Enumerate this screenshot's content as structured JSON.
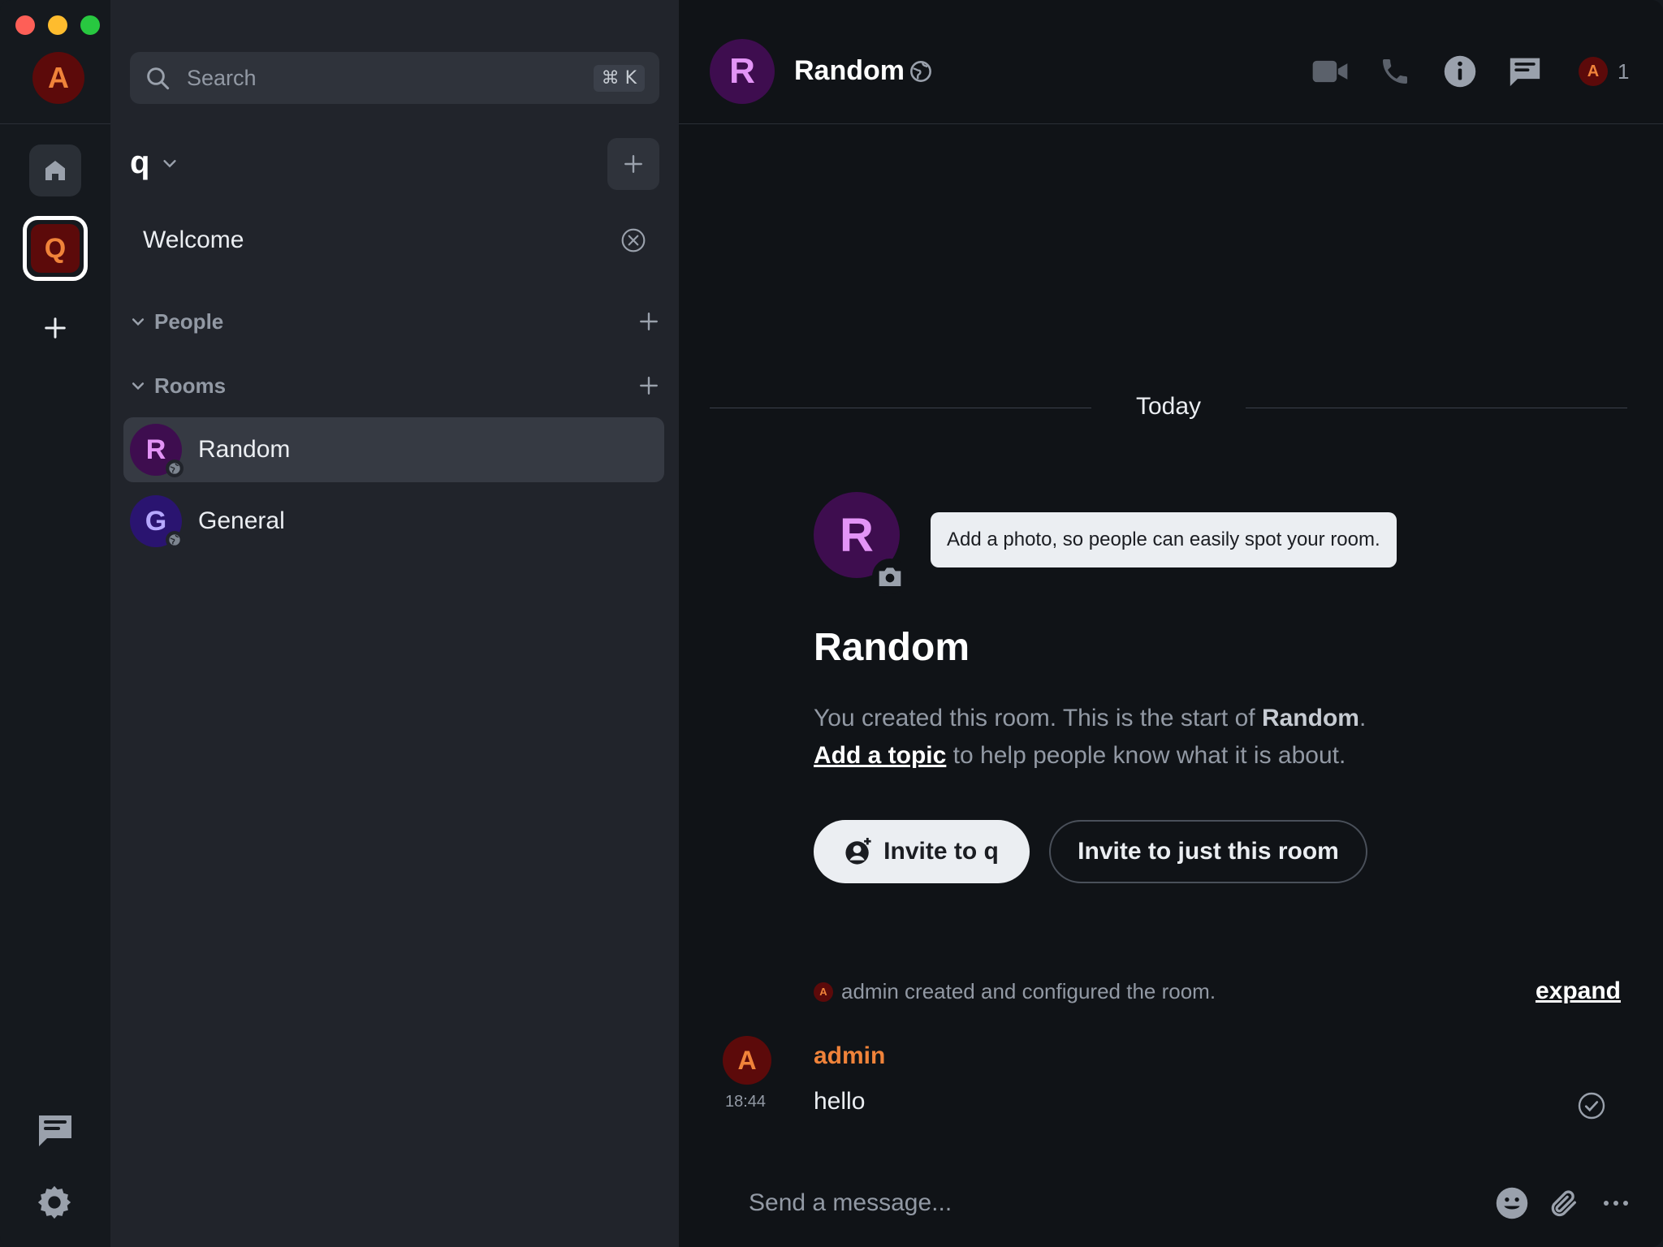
{
  "colors": {
    "background": "#15191e",
    "roomlist_bg": "#21242b",
    "timeline_bg": "#101317",
    "accent_orange": "#f0833a",
    "avatar_red": "#5c0a0a",
    "avatar_purple": "#3e0d4f",
    "avatar_indigo": "#2a1470"
  },
  "spacebar": {
    "user_avatar_letter": "A",
    "space_letter": "Q",
    "icons": [
      "home-icon",
      "plus-icon",
      "threads-icon",
      "gear-icon"
    ]
  },
  "roomlist": {
    "search_placeholder": "Search",
    "search_shortcut": "⌘ K",
    "space_name": "q",
    "welcome_label": "Welcome",
    "sections": {
      "people": "People",
      "rooms": "Rooms"
    },
    "rooms": [
      {
        "letter": "R",
        "name": "Random",
        "active": true
      },
      {
        "letter": "G",
        "name": "General",
        "active": false
      }
    ]
  },
  "header": {
    "avatar_letter": "R",
    "title": "Random",
    "member_avatar_letter": "A",
    "member_count": "1"
  },
  "timeline": {
    "date_separator": "Today",
    "new_room": {
      "avatar_letter": "R",
      "photo_tooltip": "Add a photo, so people can easily spot your room.",
      "title": "Random",
      "intro_part1": "You created this room. This is the start of ",
      "intro_room": "Random",
      "intro_part2": ".",
      "topic_link": "Add a topic",
      "topic_rest": " to help people know what it is about.",
      "invite_space_label": "Invite to q",
      "invite_room_label": "Invite to just this room"
    },
    "event_summary": {
      "avatar_letter": "A",
      "text": "admin created and configured the room.",
      "expand_label": "expand"
    },
    "message": {
      "avatar_letter": "A",
      "sender": "admin",
      "time": "18:44",
      "body": "hello"
    }
  },
  "composer": {
    "placeholder": "Send a message..."
  }
}
